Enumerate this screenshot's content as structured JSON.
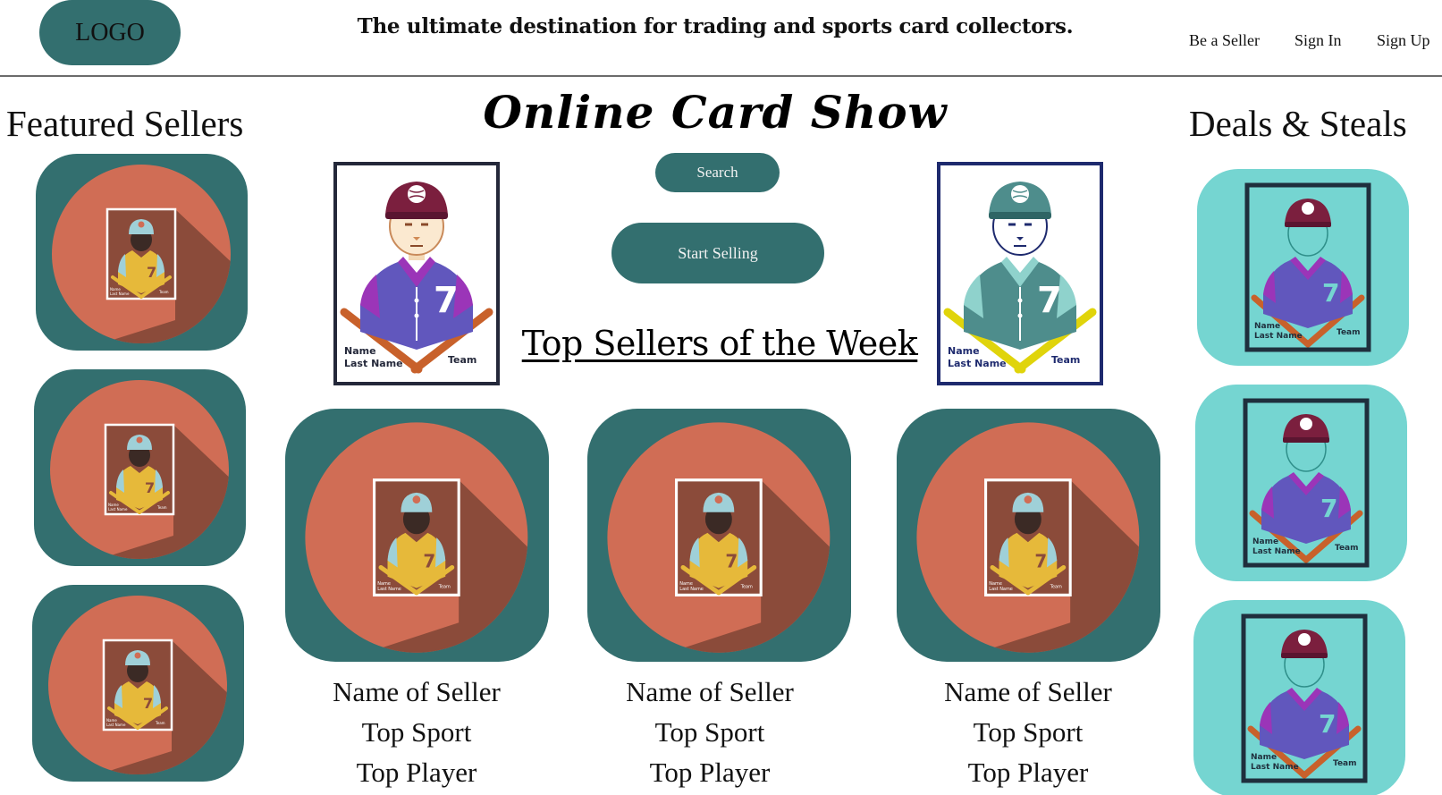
{
  "header": {
    "logo": "LOGO",
    "tagline": "The ultimate destination for trading and sports card collectors.",
    "nav": {
      "seller": "Be a Seller",
      "sign_in": "Sign In",
      "sign_up": "Sign Up"
    }
  },
  "hero": {
    "title": "Online Card Show",
    "search_label": "Search",
    "start_selling_label": "Start Selling"
  },
  "featured": {
    "title": "Featured Sellers"
  },
  "deals": {
    "title": "Deals & Steals"
  },
  "top_sellers": {
    "title": "Top Sellers of the Week",
    "sellers": [
      {
        "name": "Name of Seller",
        "sport": "Top Sport",
        "player": "Top Player"
      },
      {
        "name": "Name of Seller",
        "sport": "Top Sport",
        "player": "Top Player"
      },
      {
        "name": "Name of Seller",
        "sport": "Top Sport",
        "player": "Top Player"
      }
    ]
  },
  "card_text": {
    "name": "Name",
    "last_name": "Last Name",
    "team": "Team",
    "number": "7"
  },
  "colors": {
    "teal_dark": "#336f6f",
    "teal_light": "#75d5d1",
    "coral": "#d06d55",
    "shadow": "#8b4b3a",
    "yellow": "#e6b93a",
    "purple": "#6157bd",
    "maroon": "#7b1f3e"
  },
  "icons": [
    "baseball-card-icon",
    "baseball-player-icon"
  ]
}
